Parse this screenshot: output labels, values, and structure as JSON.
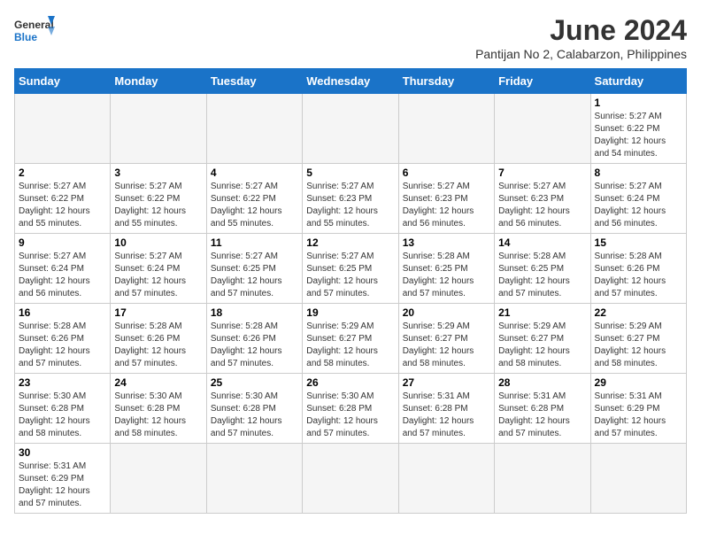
{
  "header": {
    "logo_general": "General",
    "logo_blue": "Blue",
    "month_year": "June 2024",
    "subtitle": "Pantijan No 2, Calabarzon, Philippines"
  },
  "days_of_week": [
    "Sunday",
    "Monday",
    "Tuesday",
    "Wednesday",
    "Thursday",
    "Friday",
    "Saturday"
  ],
  "weeks": [
    [
      {
        "day": "",
        "sunrise": "",
        "sunset": "",
        "daylight": ""
      },
      {
        "day": "",
        "sunrise": "",
        "sunset": "",
        "daylight": ""
      },
      {
        "day": "",
        "sunrise": "",
        "sunset": "",
        "daylight": ""
      },
      {
        "day": "",
        "sunrise": "",
        "sunset": "",
        "daylight": ""
      },
      {
        "day": "",
        "sunrise": "",
        "sunset": "",
        "daylight": ""
      },
      {
        "day": "",
        "sunrise": "",
        "sunset": "",
        "daylight": ""
      },
      {
        "day": "1",
        "sunrise": "5:27 AM",
        "sunset": "6:22 PM",
        "daylight": "12 hours and 54 minutes."
      }
    ],
    [
      {
        "day": "2",
        "sunrise": "5:27 AM",
        "sunset": "6:22 PM",
        "daylight": "12 hours and 55 minutes."
      },
      {
        "day": "3",
        "sunrise": "5:27 AM",
        "sunset": "6:22 PM",
        "daylight": "12 hours and 55 minutes."
      },
      {
        "day": "4",
        "sunrise": "5:27 AM",
        "sunset": "6:22 PM",
        "daylight": "12 hours and 55 minutes."
      },
      {
        "day": "5",
        "sunrise": "5:27 AM",
        "sunset": "6:23 PM",
        "daylight": "12 hours and 55 minutes."
      },
      {
        "day": "6",
        "sunrise": "5:27 AM",
        "sunset": "6:23 PM",
        "daylight": "12 hours and 56 minutes."
      },
      {
        "day": "7",
        "sunrise": "5:27 AM",
        "sunset": "6:23 PM",
        "daylight": "12 hours and 56 minutes."
      },
      {
        "day": "8",
        "sunrise": "5:27 AM",
        "sunset": "6:24 PM",
        "daylight": "12 hours and 56 minutes."
      }
    ],
    [
      {
        "day": "9",
        "sunrise": "5:27 AM",
        "sunset": "6:24 PM",
        "daylight": "12 hours and 56 minutes."
      },
      {
        "day": "10",
        "sunrise": "5:27 AM",
        "sunset": "6:24 PM",
        "daylight": "12 hours and 57 minutes."
      },
      {
        "day": "11",
        "sunrise": "5:27 AM",
        "sunset": "6:25 PM",
        "daylight": "12 hours and 57 minutes."
      },
      {
        "day": "12",
        "sunrise": "5:27 AM",
        "sunset": "6:25 PM",
        "daylight": "12 hours and 57 minutes."
      },
      {
        "day": "13",
        "sunrise": "5:28 AM",
        "sunset": "6:25 PM",
        "daylight": "12 hours and 57 minutes."
      },
      {
        "day": "14",
        "sunrise": "5:28 AM",
        "sunset": "6:25 PM",
        "daylight": "12 hours and 57 minutes."
      },
      {
        "day": "15",
        "sunrise": "5:28 AM",
        "sunset": "6:26 PM",
        "daylight": "12 hours and 57 minutes."
      }
    ],
    [
      {
        "day": "16",
        "sunrise": "5:28 AM",
        "sunset": "6:26 PM",
        "daylight": "12 hours and 57 minutes."
      },
      {
        "day": "17",
        "sunrise": "5:28 AM",
        "sunset": "6:26 PM",
        "daylight": "12 hours and 57 minutes."
      },
      {
        "day": "18",
        "sunrise": "5:28 AM",
        "sunset": "6:26 PM",
        "daylight": "12 hours and 57 minutes."
      },
      {
        "day": "19",
        "sunrise": "5:29 AM",
        "sunset": "6:27 PM",
        "daylight": "12 hours and 58 minutes."
      },
      {
        "day": "20",
        "sunrise": "5:29 AM",
        "sunset": "6:27 PM",
        "daylight": "12 hours and 58 minutes."
      },
      {
        "day": "21",
        "sunrise": "5:29 AM",
        "sunset": "6:27 PM",
        "daylight": "12 hours and 58 minutes."
      },
      {
        "day": "22",
        "sunrise": "5:29 AM",
        "sunset": "6:27 PM",
        "daylight": "12 hours and 58 minutes."
      }
    ],
    [
      {
        "day": "23",
        "sunrise": "5:30 AM",
        "sunset": "6:28 PM",
        "daylight": "12 hours and 58 minutes."
      },
      {
        "day": "24",
        "sunrise": "5:30 AM",
        "sunset": "6:28 PM",
        "daylight": "12 hours and 58 minutes."
      },
      {
        "day": "25",
        "sunrise": "5:30 AM",
        "sunset": "6:28 PM",
        "daylight": "12 hours and 57 minutes."
      },
      {
        "day": "26",
        "sunrise": "5:30 AM",
        "sunset": "6:28 PM",
        "daylight": "12 hours and 57 minutes."
      },
      {
        "day": "27",
        "sunrise": "5:31 AM",
        "sunset": "6:28 PM",
        "daylight": "12 hours and 57 minutes."
      },
      {
        "day": "28",
        "sunrise": "5:31 AM",
        "sunset": "6:28 PM",
        "daylight": "12 hours and 57 minutes."
      },
      {
        "day": "29",
        "sunrise": "5:31 AM",
        "sunset": "6:29 PM",
        "daylight": "12 hours and 57 minutes."
      }
    ],
    [
      {
        "day": "30",
        "sunrise": "5:31 AM",
        "sunset": "6:29 PM",
        "daylight": "12 hours and 57 minutes."
      },
      {
        "day": "",
        "sunrise": "",
        "sunset": "",
        "daylight": ""
      },
      {
        "day": "",
        "sunrise": "",
        "sunset": "",
        "daylight": ""
      },
      {
        "day": "",
        "sunrise": "",
        "sunset": "",
        "daylight": ""
      },
      {
        "day": "",
        "sunrise": "",
        "sunset": "",
        "daylight": ""
      },
      {
        "day": "",
        "sunrise": "",
        "sunset": "",
        "daylight": ""
      },
      {
        "day": "",
        "sunrise": "",
        "sunset": "",
        "daylight": ""
      }
    ]
  ]
}
